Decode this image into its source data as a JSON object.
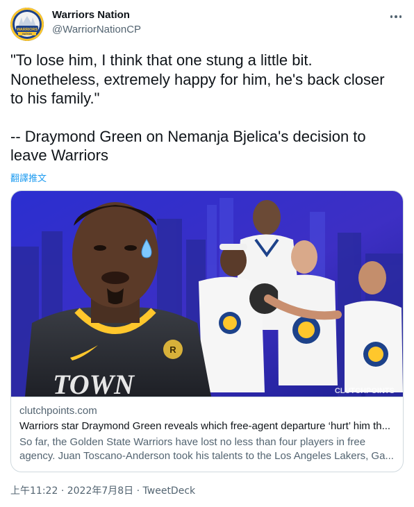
{
  "author": {
    "display_name": "Warriors Nation",
    "handle": "@WarriorNationCP",
    "avatar_icon": "warriors-nation-logo-icon",
    "avatar_text": "WARRIORS NATION"
  },
  "more_icon": "more-options-icon",
  "tweet": {
    "paragraph_1": "\"To lose him, I think that one stung a little bit.\nNonetheless, extremely happy for him, he's back closer\nto his family.\"",
    "paragraph_2": "-- Draymond Green on Nemanja Bjelica's decision to\nleave Warriors",
    "translate_label": "翻譯推文"
  },
  "card": {
    "image_watermark": "CLUTCHPOINTS",
    "domain": "clutchpoints.com",
    "title": "Warriors star Draymond Green reveals which free-agent departure ‘hurt’ him th...",
    "description_line_1": "So far, the Golden State Warriors have lost no less than four players in free",
    "description_line_2": "agency. Juan Toscano-Anderson took his talents to the Los Angeles Lakers, Ga..."
  },
  "footer": {
    "time": "上午11:22",
    "separator": "·",
    "date": "2022年7月8日",
    "source": "TweetDeck"
  },
  "colors": {
    "link_blue": "#1d9bf0",
    "secondary_text": "#536471",
    "warriors_blue": "#1d428a",
    "warriors_gold": "#ffc72c"
  }
}
